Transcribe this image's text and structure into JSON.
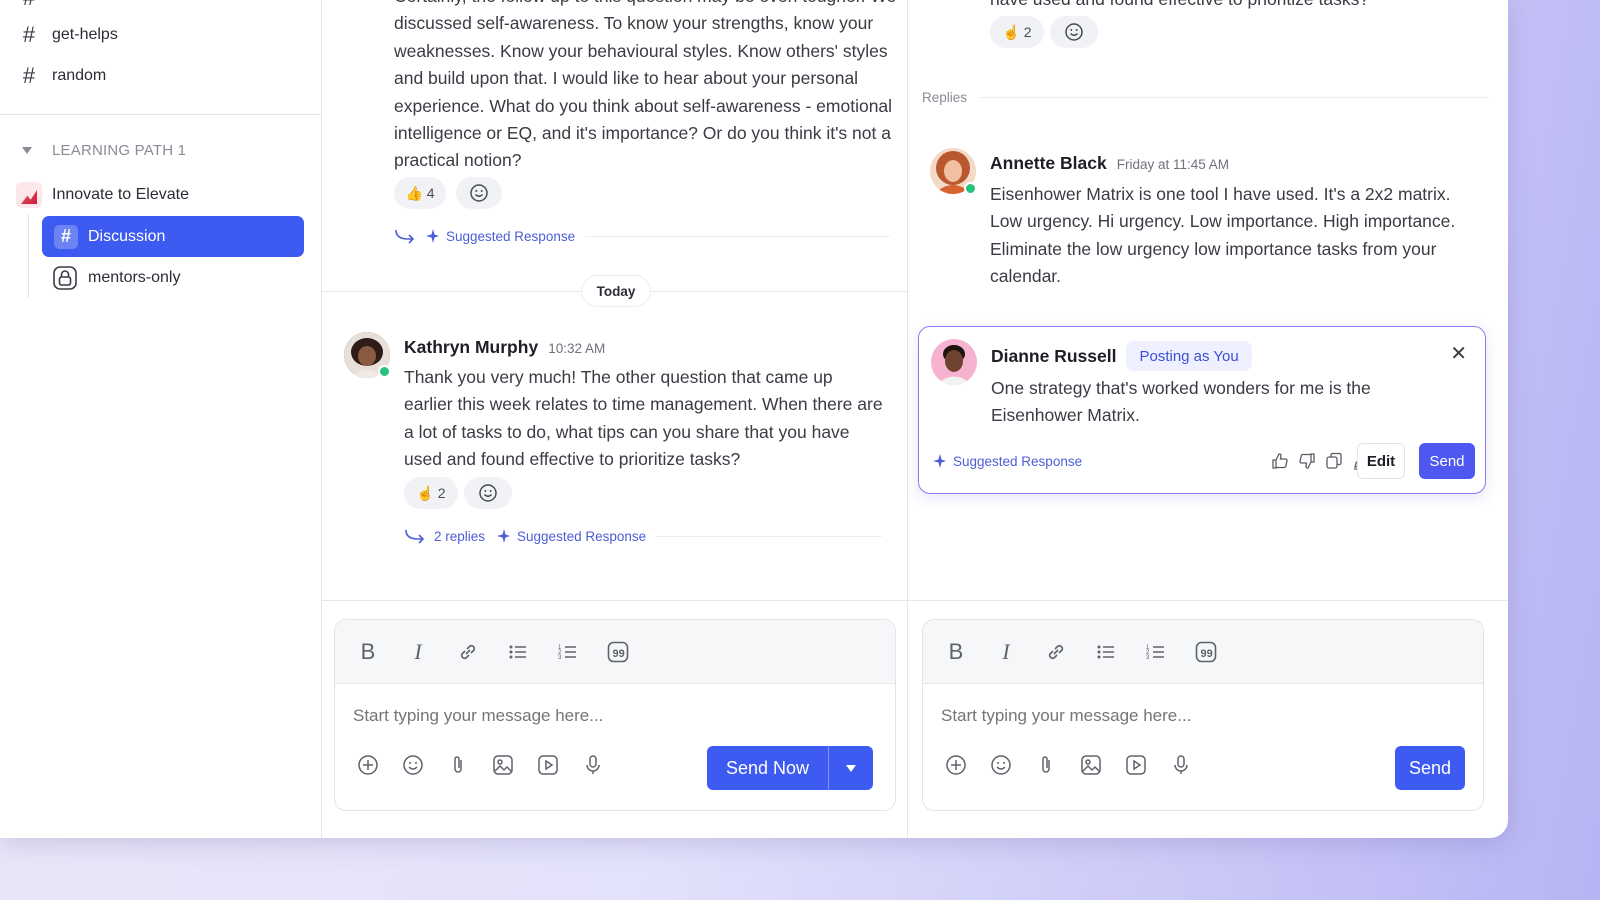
{
  "sidebar": {
    "channels": [
      {
        "label": "get-helps"
      },
      {
        "label": "random"
      }
    ],
    "section_label": "LEARNING PATH 1",
    "course_name": "Innovate to Elevate",
    "active_channel": "Discussion",
    "private_channel": "mentors-only"
  },
  "main": {
    "previous_message": {
      "text": "Certainly, the follow up to this question may be even tougher. We discussed self-awareness. To know your strengths, know your weaknesses. Know your behavioural styles. Know others' styles and build upon that. I would like to hear about your personal experience. What do you think about self-awareness - emotional intelligence or EQ, and it's importance? Or do you think it's not a practical notion?",
      "reaction": "👍 4",
      "suggested_label": "Suggested Response"
    },
    "day_divider": "Today",
    "message": {
      "author": "Kathryn Murphy",
      "time": "10:32 AM",
      "text": "Thank you very much! The other question that came up earlier this week relates to time management. When there are a lot of tasks to do, what tips can you share that you have used and found effective to prioritize tasks?",
      "reaction": "☝ 2",
      "replies_label": "2 replies",
      "suggested_label": "Suggested Response"
    },
    "composer": {
      "placeholder": "Start typing your message here...",
      "send_label": "Send Now"
    }
  },
  "thread": {
    "parent_tail": "have used and found effective to prioritize tasks?",
    "parent_reaction": "☝ 2",
    "replies_label": "Replies",
    "reply": {
      "author": "Annette Black",
      "time": "Friday at 11:45 AM",
      "text": "Eisenhower Matrix is one tool I have used. It's a 2x2 matrix. Low urgency. Hi urgency. Low importance. High importance. Eliminate the low urgency low importance tasks from your calendar."
    },
    "draft": {
      "author": "Dianne Russell",
      "badge": "Posting as You",
      "text": "One strategy that's worked wonders for me is the Eisenhower Matrix.",
      "suggested_label": "Suggested Response",
      "edit_label": "Edit",
      "send_label": "Send"
    },
    "composer": {
      "placeholder": "Start typing your message here...",
      "send_label": "Send"
    }
  },
  "colors": {
    "accent": "#3d5af1",
    "online": "#27c07d",
    "draft_border": "#8a7df0"
  }
}
